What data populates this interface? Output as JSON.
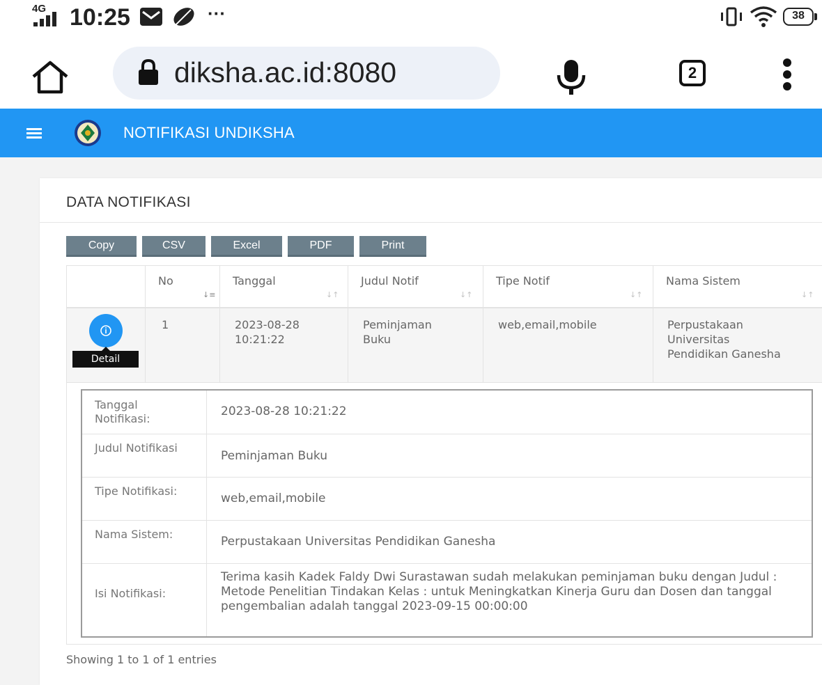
{
  "status_bar": {
    "network": "4G",
    "time": "10:25",
    "more": "···",
    "battery": "38"
  },
  "browser": {
    "url": "diksha.ac.id:8080",
    "tab_count": "2"
  },
  "app_bar": {
    "title": "NOTIFIKASI UNDIKSHA"
  },
  "card": {
    "title": "DATA NOTIFIKASI"
  },
  "export_buttons": [
    "Copy",
    "CSV",
    "Excel",
    "PDF",
    "Print"
  ],
  "table": {
    "headers": [
      "No",
      "Tanggal",
      "Judul Notif",
      "Tipe Notif",
      "Nama Sistem"
    ],
    "rows": [
      {
        "no": "1",
        "tanggal": "2023-08-28 10:21:22",
        "judul": "Peminjaman Buku",
        "tipe": "web,email,mobile",
        "sistem": "Perpustakaan Universitas Pendidikan Ganesha",
        "detail_label": "Detail"
      }
    ]
  },
  "detail": [
    {
      "label": "Tanggal Notifikasi:",
      "value": "2023-08-28 10:21:22"
    },
    {
      "label": "Judul Notifikasi",
      "value": "Peminjaman Buku"
    },
    {
      "label": "Tipe Notifikasi:",
      "value": "web,email,mobile"
    },
    {
      "label": "Nama Sistem:",
      "value": "Perpustakaan Universitas Pendidikan Ganesha"
    },
    {
      "label": "Isi Notifikasi:",
      "value": "Terima kasih Kadek Faldy Dwi Surastawan sudah melakukan peminjaman buku dengan Judul : Metode Penelitian Tindakan Kelas : untuk Meningkatkan Kinerja Guru dan Dosen dan tanggal pengembalian adalah tanggal 2023-09-15 00:00:00"
    }
  ],
  "footer": {
    "info": "Showing 1 to 1 of 1 entries"
  },
  "colors": {
    "primary": "#2196f3",
    "button": "#6c808c"
  }
}
